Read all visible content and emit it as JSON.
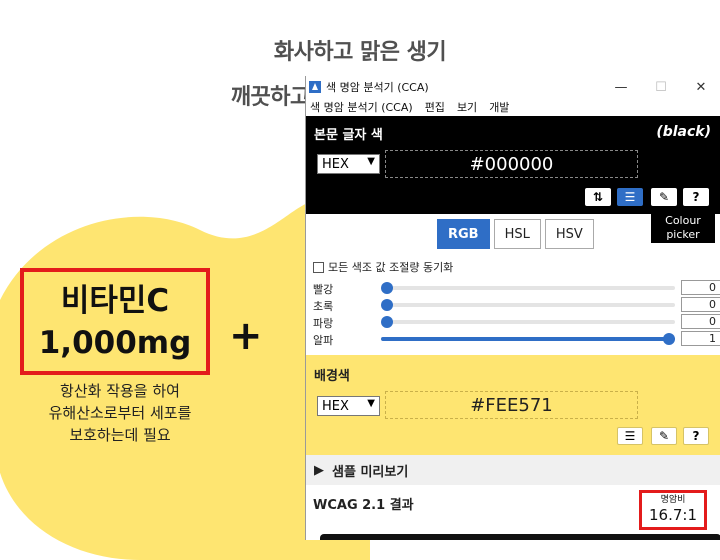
{
  "page": {
    "headline_line1": "화사하고 맑은 생기",
    "headline_line2": "깨끗하고 투명한 일상을 위해",
    "vitamin_name": "비타민C",
    "vitamin_amount": "1,000mg",
    "plus": "+",
    "desc_lines": [
      "항산화 작용을 하여",
      "유해산소로부터 세포를",
      "보호하는데 필요"
    ],
    "blob_color": "#fee571"
  },
  "window": {
    "title": "색 명암 분석기 (CCA)",
    "controls": {
      "minimize": "—",
      "maximize": "☐",
      "close": "✕"
    },
    "menu": [
      "색 명암 분석기 (CCA)",
      "편집",
      "보기",
      "개발"
    ],
    "foreground": {
      "title": "본문 글자 색",
      "color_name": "(black)",
      "format": "HEX",
      "hex": "#000000",
      "color": "#000000",
      "tools": [
        "swap-icon",
        "sliders-icon",
        "eyedropper-icon",
        "help-icon"
      ],
      "tooltip": [
        "Colour",
        "picker"
      ]
    },
    "tabs": [
      "RGB",
      "HSL",
      "HSV"
    ],
    "active_tab": "RGB",
    "sync_label": "모든 색조 값 조절량 동기화",
    "sliders": [
      {
        "label": "빨강",
        "value": "0",
        "level": 0
      },
      {
        "label": "초록",
        "value": "0",
        "level": 0
      },
      {
        "label": "파랑",
        "value": "0",
        "level": 0
      },
      {
        "label": "알파",
        "value": "1",
        "level": 1
      }
    ],
    "background": {
      "title": "배경색",
      "format": "HEX",
      "hex": "#FEE571",
      "color": "#fee571",
      "tools": [
        "sliders-icon",
        "eyedropper-icon",
        "help-icon"
      ]
    },
    "preview_label": "샘플 미리보기",
    "wcag_label": "WCAG 2.1 결과",
    "ratio_label": "명암비",
    "ratio_value": "16.7:1",
    "accent": "#2f6ec6",
    "highlight": "#e31b1b"
  }
}
